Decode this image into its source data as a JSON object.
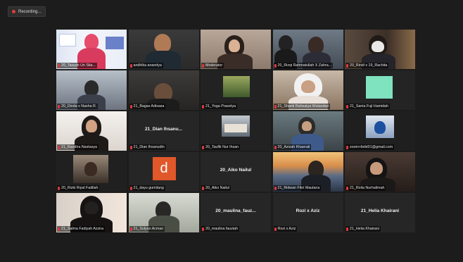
{
  "recording": {
    "label": "Recording..."
  },
  "tiles": [
    {
      "name": "20_Tasyah Un Stia..."
    },
    {
      "name": "andhika anandya"
    },
    {
      "name": "Moderator"
    },
    {
      "name": "20_Rizqi Rahmatullah X Zahra..."
    },
    {
      "name": "20_Rindi x 19_Rachita"
    },
    {
      "name": "20_Dinda x Nasha R."
    },
    {
      "name": "21_Bagas Adisasa"
    },
    {
      "name": "21_Yoga Prasetya"
    },
    {
      "name": "21_Shanti Rahsatya Wulandari"
    },
    {
      "name": "21_Sania Fuji Hamidah"
    },
    {
      "name": "21_Randira Nastasya"
    },
    {
      "name": "21_Dian Ihsanudin",
      "display_name": "21_Dian Ihsanu..."
    },
    {
      "name": "20_Taufik Nur Ihsan"
    },
    {
      "name": "20_Azizah Khaerati"
    },
    {
      "name": "zoom+liebt01@gmail.com"
    },
    {
      "name": "20_Rizki Riyal Fadilah"
    },
    {
      "name": "21_dayu gumilang",
      "avatar_letter": "d",
      "avatar_color": "#e0572a"
    },
    {
      "name": "20_Aiko Nailul",
      "display_name": "20_Aiko Nailul"
    },
    {
      "name": "21_Ridwan Fikri Maulana"
    },
    {
      "name": "21_Rolia Nurhalimah"
    },
    {
      "name": "21_Salma Fadiyah Azzira"
    },
    {
      "name": "21_Sulyan Acman"
    },
    {
      "name": "20_maulina fauziah",
      "display_name": "20_maulina_fauz..."
    },
    {
      "name": "Rozi x Aziz",
      "display_name": "Rozi x Aziz"
    },
    {
      "name": "21_Helia Khairani",
      "display_name": "21_Helia Khairani"
    }
  ]
}
